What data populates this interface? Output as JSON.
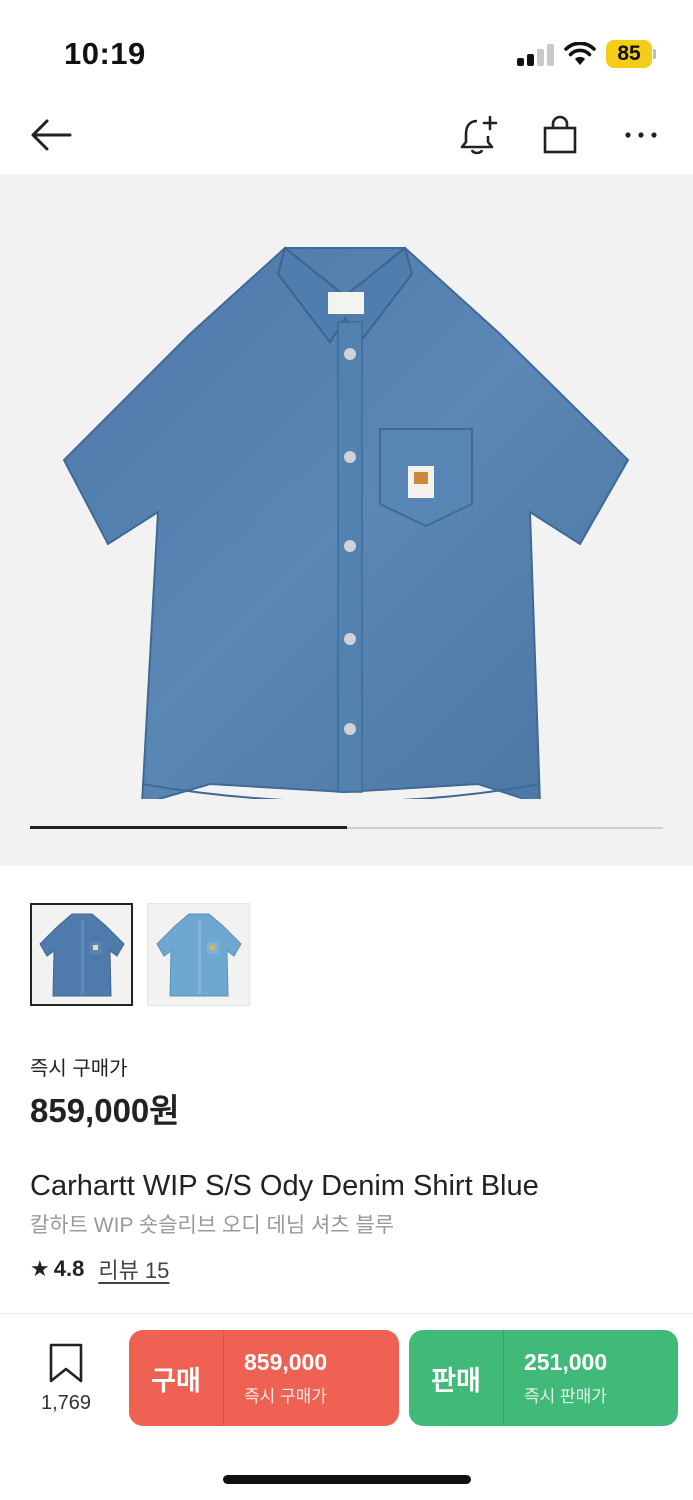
{
  "status_bar": {
    "time": "10:19",
    "battery_percent": "85",
    "icons": [
      "cellular-signal-icon",
      "wifi-icon",
      "battery-icon"
    ]
  },
  "header": {
    "icons": [
      "back-arrow-icon",
      "bell-plus-icon",
      "shopping-bag-icon",
      "more-dots-icon"
    ]
  },
  "gallery": {
    "image_description_icon": "denim-shirt-image",
    "progress_fraction": 0.5
  },
  "thumbnails": [
    {
      "variant": "dark-blue-denim-shirt",
      "selected": true
    },
    {
      "variant": "light-blue-denim-shirt",
      "selected": false
    }
  ],
  "product": {
    "price_label": "즉시 구매가",
    "price": "859,000원",
    "title_en": "Carhartt WIP S/S Ody Denim Shirt Blue",
    "title_ko": "칼하트 WIP 숏슬리브 오디 데님 셔츠 블루",
    "rating": "4.8",
    "reviews_label": "리뷰 15"
  },
  "bottom_bar": {
    "wish_count": "1,769",
    "buy": {
      "label": "구매",
      "price": "859,000",
      "caption": "즉시 구매가",
      "color": "#ef6253"
    },
    "sell": {
      "label": "판매",
      "price": "251,000",
      "caption": "즉시 판매가",
      "color": "#41b979"
    }
  }
}
